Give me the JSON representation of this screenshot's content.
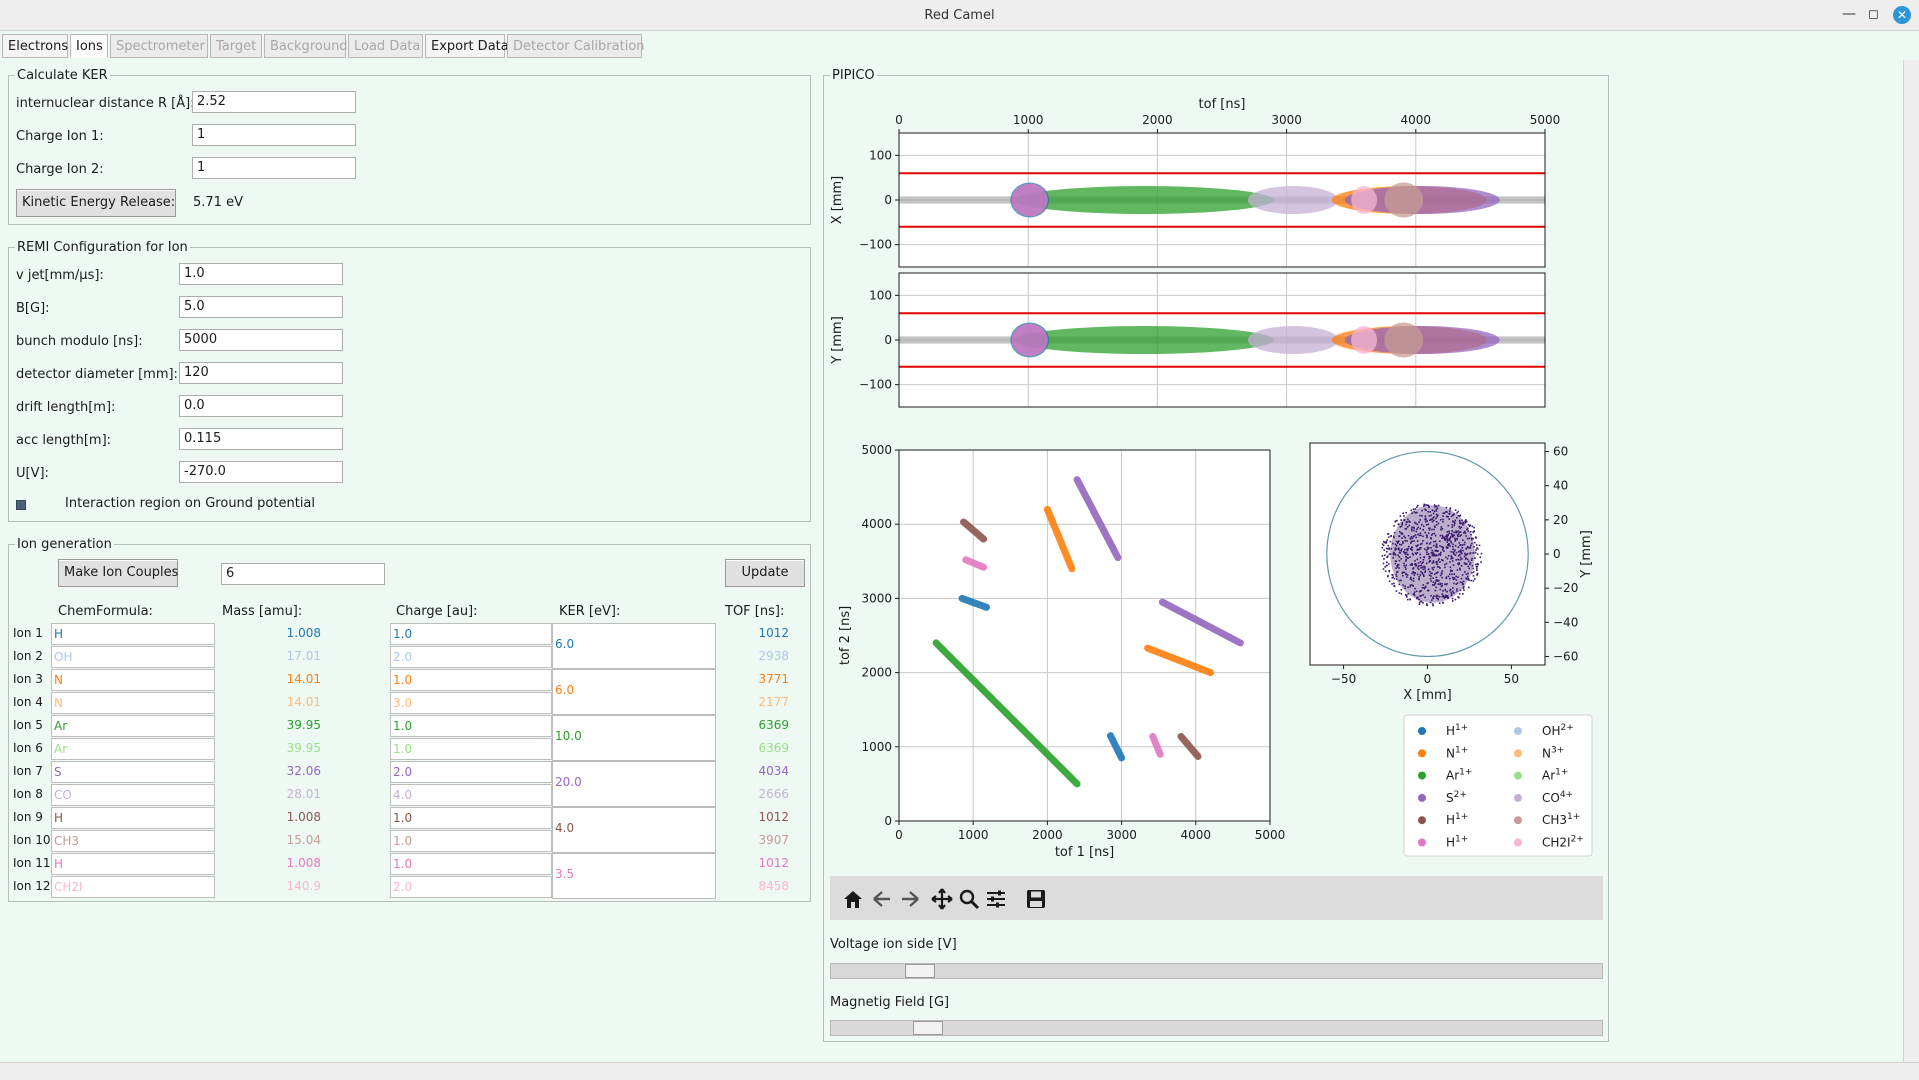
{
  "window": {
    "title": "Red Camel"
  },
  "tabs": [
    {
      "label": "Electrons",
      "state": "normal"
    },
    {
      "label": "Ions",
      "state": "selected"
    },
    {
      "label": "Spectrometer",
      "state": "disabled"
    },
    {
      "label": "Target",
      "state": "disabled"
    },
    {
      "label": "Background",
      "state": "disabled"
    },
    {
      "label": "Load Data",
      "state": "disabled"
    },
    {
      "label": "Export Data",
      "state": "normal"
    },
    {
      "label": "Detector Calibration",
      "state": "disabled"
    }
  ],
  "ker": {
    "title": "Calculate KER",
    "fields": [
      {
        "label": "internuclear distance R [Å]:",
        "value": "2.52"
      },
      {
        "label": "Charge Ion 1:",
        "value": "1"
      },
      {
        "label": "Charge Ion 2:",
        "value": "1"
      }
    ],
    "button": "Kinetic Energy Release:",
    "result": "5.71 eV"
  },
  "remi": {
    "title": "REMI Configuration for Ion",
    "fields": [
      {
        "label": "v jet[mm/µs]:",
        "value": "1.0"
      },
      {
        "label": "B[G]:",
        "value": "5.0"
      },
      {
        "label": "bunch modulo [ns]:",
        "value": "5000"
      },
      {
        "label": "detector diameter [mm]:",
        "value": "120"
      },
      {
        "label": "drift length[m]:",
        "value": "0.0"
      },
      {
        "label": "acc length[m]:",
        "value": "0.115"
      },
      {
        "label": "U[V]:",
        "value": "-270.0"
      }
    ],
    "checkbox": "Interaction region on Ground potential"
  },
  "iongen": {
    "title": "Ion generation",
    "make_button": "Make Ion Couples",
    "count": "6",
    "update_button": "Update",
    "headers": {
      "chem": "ChemFormula:",
      "mass": "Mass [amu]:",
      "charge": "Charge [au]:",
      "ker": "KER [eV]:",
      "tof": "TOF [ns]:"
    },
    "ions": [
      {
        "label": "Ion 1",
        "chem": "H",
        "mass": "1.008",
        "charge": "1.0",
        "tof": "1012",
        "color": "#1f77b4"
      },
      {
        "label": "Ion 2",
        "chem": "OH",
        "mass": "17.01",
        "charge": "2.0",
        "tof": "2938",
        "color": "#aec7e8"
      },
      {
        "label": "Ion 3",
        "chem": "N",
        "mass": "14.01",
        "charge": "1.0",
        "tof": "3771",
        "color": "#ff7f0e"
      },
      {
        "label": "Ion 4",
        "chem": "N",
        "mass": "14.01",
        "charge": "3.0",
        "tof": "2177",
        "color": "#ffbb78"
      },
      {
        "label": "Ion 5",
        "chem": "Ar",
        "mass": "39.95",
        "charge": "1.0",
        "tof": "6369",
        "color": "#2ca02c"
      },
      {
        "label": "Ion 6",
        "chem": "Ar",
        "mass": "39.95",
        "charge": "1.0",
        "tof": "6369",
        "color": "#98df8a"
      },
      {
        "label": "Ion 7",
        "chem": "S",
        "mass": "32.06",
        "charge": "2.0",
        "tof": "4034",
        "color": "#9467bd"
      },
      {
        "label": "Ion 8",
        "chem": "CO",
        "mass": "28.01",
        "charge": "4.0",
        "tof": "2666",
        "color": "#c5b0d5"
      },
      {
        "label": "Ion 9",
        "chem": "H",
        "mass": "1.008",
        "charge": "1.0",
        "tof": "1012",
        "color": "#8c564b"
      },
      {
        "label": "Ion 10",
        "chem": "CH3",
        "mass": "15.04",
        "charge": "1.0",
        "tof": "3907",
        "color": "#c49c94"
      },
      {
        "label": "Ion 11",
        "chem": "H",
        "mass": "1.008",
        "charge": "1.0",
        "tof": "1012",
        "color": "#e377c2"
      },
      {
        "label": "Ion 12",
        "chem": "CH2I",
        "mass": "140.9",
        "charge": "2.0",
        "tof": "8458",
        "color": "#f7b6d2"
      }
    ],
    "kers": [
      {
        "value": "6.0",
        "color": "#1f77b4"
      },
      {
        "value": "6.0",
        "color": "#ff7f0e"
      },
      {
        "value": "10.0",
        "color": "#2ca02c"
      },
      {
        "value": "20.0",
        "color": "#9467bd"
      },
      {
        "value": "4.0",
        "color": "#8c564b"
      },
      {
        "value": "3.5",
        "color": "#e377c2"
      }
    ]
  },
  "pipico": {
    "title": "PIPICO",
    "voltage_label": "Voltage ion side [V]",
    "voltage_pct": 0.1,
    "field_label": "Magnetig Field [G]",
    "field_pct": 0.11,
    "toolbar": [
      "home-icon",
      "back-icon",
      "forward-icon",
      "pan-icon",
      "zoom-icon",
      "configure-icon",
      "save-icon"
    ]
  },
  "chart_data": [
    {
      "type": "scatter",
      "xlabel": "tof [ns]",
      "ylabel": "X [mm]",
      "xlim": [
        0,
        5000
      ],
      "ylim": [
        -150,
        150
      ],
      "xticks": [
        "0",
        "1000",
        "2000",
        "3000",
        "4000",
        "5000"
      ],
      "yticks": [
        "100",
        "0",
        "−100"
      ],
      "grid": true,
      "lines_at_y": [
        60,
        -60
      ],
      "clusters": [
        {
          "x_center": 1900,
          "x_halfwidth": 1000,
          "color": "#2ca02c"
        },
        {
          "x_center": 1012,
          "x_halfwidth": 150,
          "color": "#1f77b4"
        },
        {
          "x_center": 3050,
          "x_halfwidth": 350,
          "color": "#c5b0d5"
        },
        {
          "x_center": 3950,
          "x_halfwidth": 600,
          "color": "#ff7f0e"
        },
        {
          "x_center": 4050,
          "x_halfwidth": 600,
          "color": "#9467bd"
        },
        {
          "x_center": 3907,
          "x_halfwidth": 150,
          "color": "#c49c94"
        },
        {
          "x_center": 3600,
          "x_halfwidth": 100,
          "color": "#f7b6d2"
        },
        {
          "x_center": 1012,
          "x_halfwidth": 140,
          "color": "#e377c2"
        }
      ]
    },
    {
      "type": "scatter",
      "ylabel": "Y [mm]",
      "xlim": [
        0,
        5000
      ],
      "ylim": [
        -150,
        150
      ],
      "yticks": [
        "100",
        "0",
        "−100"
      ],
      "grid": true,
      "lines_at_y": [
        60,
        -60
      ]
    },
    {
      "type": "line",
      "xlabel": "tof 1 [ns]",
      "ylabel": "tof 2 [ns]",
      "xlim": [
        0,
        5000
      ],
      "ylim": [
        0,
        5000
      ],
      "xticks": [
        "0",
        "1000",
        "2000",
        "3000",
        "4000",
        "5000"
      ],
      "yticks": [
        "0",
        "1000",
        "2000",
        "3000",
        "4000",
        "5000"
      ],
      "grid": true,
      "series": [
        {
          "color": "#1f77b4",
          "segments": [
            [
              [
                850,
                3000
              ],
              [
                1180,
                2880
              ]
            ],
            [
              [
                2850,
                1150
              ],
              [
                3000,
                850
              ]
            ]
          ]
        },
        {
          "color": "#ff7f0e",
          "segments": [
            [
              [
                2000,
                4200
              ],
              [
                2330,
                3400
              ]
            ],
            [
              [
                3350,
                2330
              ],
              [
                4200,
                2000
              ]
            ]
          ]
        },
        {
          "color": "#2ca02c",
          "segments": [
            [
              [
                500,
                2400
              ],
              [
                2400,
                500
              ]
            ]
          ]
        },
        {
          "color": "#9467bd",
          "segments": [
            [
              [
                2400,
                4600
              ],
              [
                2950,
                3550
              ]
            ],
            [
              [
                3550,
                2950
              ],
              [
                4600,
                2400
              ]
            ]
          ]
        },
        {
          "color": "#8c564b",
          "segments": [
            [
              [
                870,
                4030
              ],
              [
                1140,
                3800
              ]
            ],
            [
              [
                3800,
                1140
              ],
              [
                4030,
                870
              ]
            ]
          ]
        },
        {
          "color": "#e377c2",
          "segments": [
            [
              [
                900,
                3520
              ],
              [
                1140,
                3420
              ]
            ],
            [
              [
                3420,
                1140
              ],
              [
                3520,
                900
              ]
            ]
          ]
        }
      ]
    },
    {
      "type": "scatter",
      "xlabel": "X [mm]",
      "ylabel": "Y [mm]",
      "xlim": [
        -70,
        70
      ],
      "ylim": [
        -65,
        65
      ],
      "xticks": [
        "−50",
        "0",
        "50"
      ],
      "yticks": [
        "60",
        "40",
        "20",
        "0",
        "−20",
        "−40",
        "−60"
      ],
      "detector_radius": 60,
      "legend": [
        {
          "label": "H",
          "sup": "1+",
          "color": "#1f77b4"
        },
        {
          "label": "OH",
          "sup": "2+",
          "color": "#aec7e8"
        },
        {
          "label": "N",
          "sup": "1+",
          "color": "#ff7f0e"
        },
        {
          "label": "N",
          "sup": "3+",
          "color": "#ffbb78"
        },
        {
          "label": "Ar",
          "sup": "1+",
          "color": "#2ca02c"
        },
        {
          "label": "Ar",
          "sup": "1+",
          "color": "#98df8a"
        },
        {
          "label": "S",
          "sup": "2+",
          "color": "#9467bd"
        },
        {
          "label": "CO",
          "sup": "4+",
          "color": "#c5b0d5"
        },
        {
          "label": "H",
          "sup": "1+",
          "color": "#8c564b"
        },
        {
          "label": "CH3",
          "sup": "1+",
          "color": "#c49c94"
        },
        {
          "label": "H",
          "sup": "1+",
          "color": "#e377c2"
        },
        {
          "label": "CH2I",
          "sup": "2+",
          "color": "#f7b6d2"
        }
      ]
    }
  ]
}
